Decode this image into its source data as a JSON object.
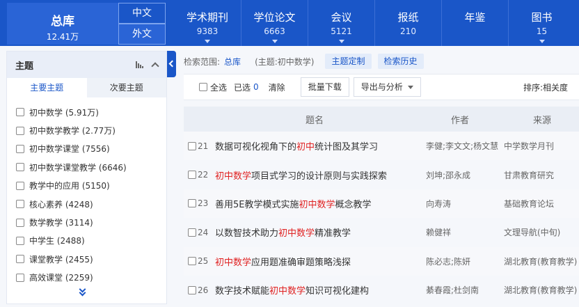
{
  "header": {
    "total_label": "总库",
    "total_count": "12.41万",
    "lang_zh": "中文",
    "lang_en": "外文",
    "navs": [
      {
        "label": "学术期刊",
        "count": "9383"
      },
      {
        "label": "学位论文",
        "count": "6663"
      },
      {
        "label": "会议",
        "count": "5121"
      },
      {
        "label": "报纸",
        "count": "210"
      },
      {
        "label": "年鉴",
        "count": ""
      },
      {
        "label": "图书",
        "count": "15"
      }
    ]
  },
  "sidebar": {
    "title": "主题",
    "tabs": [
      "主要主题",
      "次要主题"
    ],
    "topics": [
      "初中数学 (5.91万)",
      "初中数学教学 (2.77万)",
      "初中数学课堂 (7556)",
      "初中数学课堂教学 (6646)",
      "教学中的应用 (5150)",
      "核心素养 (4248)",
      "数学教学 (3114)",
      "中学生 (2488)",
      "课堂教学 (2455)",
      "高效课堂 (2259)"
    ]
  },
  "scope": {
    "label": "检索范围:",
    "db": "总库",
    "condition": "(主题:初中数学)",
    "custom": "主题定制",
    "history": "检索历史"
  },
  "toolbar": {
    "select_all": "全选",
    "selected": "已选",
    "selected_count": "0",
    "clear": "清除",
    "batch_download": "批量下载",
    "export": "导出与分析",
    "sort": "排序:相关度"
  },
  "table": {
    "headers": {
      "title": "题名",
      "author": "作者",
      "source": "来源"
    },
    "rows": [
      {
        "num": "21",
        "pre": "数据可视化视角下的",
        "hl": "初中",
        "post": "统计图及其学习",
        "author": "李健;李文文;杨文慧",
        "source": "中学数学月刊"
      },
      {
        "num": "22",
        "pre": "",
        "hl": "初中数学",
        "post": "项目式学习的设计原则与实践探索",
        "author": "刘坤;邵永成",
        "source": "甘肃教育研究"
      },
      {
        "num": "23",
        "pre": "善用5E教学模式实施",
        "hl": "初中数学",
        "post": "概念教学",
        "author": "向寿涛",
        "source": "基础教育论坛"
      },
      {
        "num": "24",
        "pre": "以数智技术助力",
        "hl": "初中数学",
        "post": "精准教学",
        "author": "赖健祥",
        "source": "文理导航(中旬)"
      },
      {
        "num": "25",
        "pre": "",
        "hl": "初中数学",
        "post": "应用题准确审题策略浅探",
        "author": "陈必志;陈妍",
        "source": "湖北教育(教育教学)"
      },
      {
        "num": "26",
        "pre": "数字技术赋能",
        "hl": "初中数学",
        "post": "知识可视化建构",
        "author": "綦春霞;杜剑南",
        "source": "湖北教育(教育教学)"
      }
    ]
  }
}
